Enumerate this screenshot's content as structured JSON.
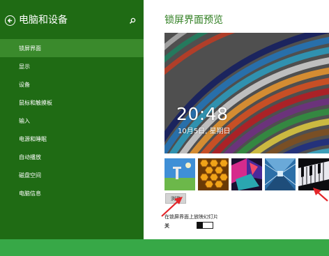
{
  "sidebar": {
    "title": "电脑和设备",
    "items": [
      {
        "label": "锁屏界面",
        "selected": true
      },
      {
        "label": "显示"
      },
      {
        "label": "设备"
      },
      {
        "label": "鼠标和触摸板"
      },
      {
        "label": "输入"
      },
      {
        "label": "电源和睡眠"
      },
      {
        "label": "自动播放"
      },
      {
        "label": "磁盘空间"
      },
      {
        "label": "电脑信息"
      }
    ]
  },
  "main": {
    "title": "锁屏界面预览",
    "preview": {
      "time": "20:48",
      "date": "10月5日, 星期日"
    },
    "thumbnails": [
      "landscape",
      "honeycomb",
      "geometric",
      "tunnel",
      "piano-keys"
    ],
    "browse_label": "浏览",
    "slideshow_label": "在锁屏界面上放映幻灯片",
    "toggle_state": "关",
    "toggle_on": false
  },
  "colors": {
    "sidebar_bg": "#1f6b14",
    "selected_bg": "#3a8a2c",
    "bottom_bar": "#37a847",
    "accent_text": "#2d7d1e",
    "annotation_arrow": "#e3262a"
  },
  "icons": {
    "back": "back-arrow-icon",
    "search": "search-icon"
  }
}
